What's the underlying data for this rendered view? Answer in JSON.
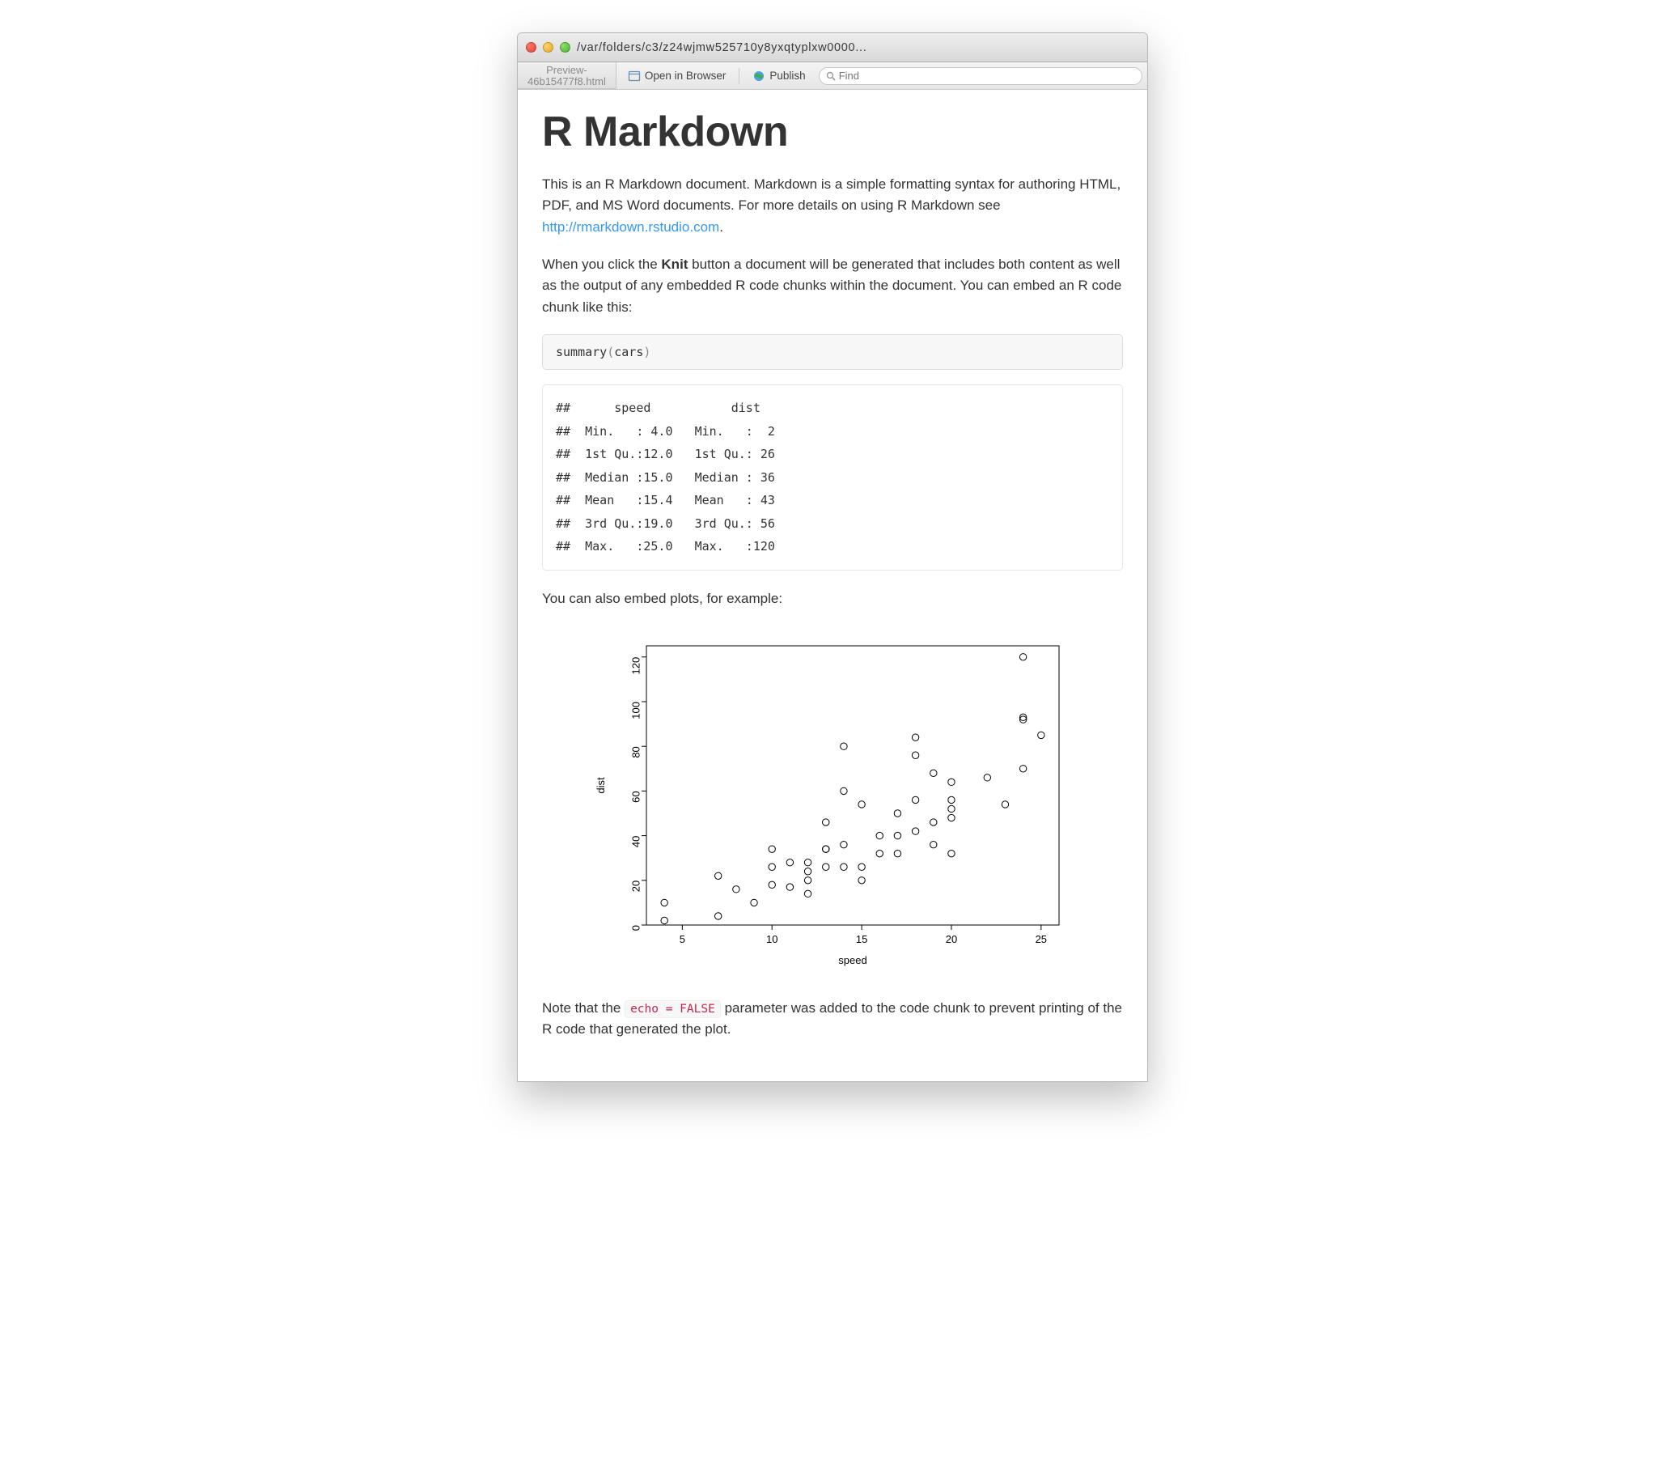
{
  "window": {
    "title_path": "/var/folders/c3/z24wjmw525710y8yxqtyplxw0000..."
  },
  "toolbar": {
    "tab": {
      "line1": "Preview-",
      "line2": "46b15477f8.html"
    },
    "open_label": "Open in Browser",
    "publish_label": "Publish",
    "search_placeholder": "Find"
  },
  "doc": {
    "heading": "R Markdown",
    "p1_a": "This is an R Markdown document. Markdown is a simple formatting syntax for authoring HTML, PDF, and MS Word documents. For more details on using R Markdown see ",
    "p1_link": "http://rmarkdown.rstudio.com",
    "p1_b": ".",
    "p2_a": "When you click the ",
    "p2_bold": "Knit",
    "p2_b": " button a document will be generated that includes both content as well as the output of any embedded R code chunks within the document. You can embed an R code chunk like this:",
    "code_fn": "summary",
    "code_arg": "cars",
    "output": "##      speed           dist    \n##  Min.   : 4.0   Min.   :  2  \n##  1st Qu.:12.0   1st Qu.: 26  \n##  Median :15.0   Median : 36  \n##  Mean   :15.4   Mean   : 43  \n##  3rd Qu.:19.0   3rd Qu.: 56  \n##  Max.   :25.0   Max.   :120",
    "p3": "You can also embed plots, for example:",
    "p4_a": "Note that the ",
    "p4_code": "echo = FALSE",
    "p4_b": " parameter was added to the code chunk to prevent printing of the R code that generated the plot."
  },
  "chart_data": {
    "type": "scatter",
    "xlabel": "speed",
    "ylabel": "dist",
    "xlim": [
      3,
      26
    ],
    "ylim": [
      0,
      125
    ],
    "xticks": [
      5,
      10,
      15,
      20,
      25
    ],
    "yticks": [
      0,
      20,
      40,
      60,
      80,
      100,
      120
    ],
    "points": [
      [
        4,
        2
      ],
      [
        4,
        10
      ],
      [
        7,
        4
      ],
      [
        7,
        22
      ],
      [
        8,
        16
      ],
      [
        9,
        10
      ],
      [
        10,
        18
      ],
      [
        10,
        26
      ],
      [
        10,
        34
      ],
      [
        11,
        17
      ],
      [
        11,
        28
      ],
      [
        12,
        14
      ],
      [
        12,
        20
      ],
      [
        12,
        24
      ],
      [
        12,
        28
      ],
      [
        13,
        26
      ],
      [
        13,
        34
      ],
      [
        13,
        34
      ],
      [
        13,
        46
      ],
      [
        14,
        26
      ],
      [
        14,
        36
      ],
      [
        14,
        60
      ],
      [
        14,
        80
      ],
      [
        15,
        20
      ],
      [
        15,
        26
      ],
      [
        15,
        54
      ],
      [
        16,
        32
      ],
      [
        16,
        40
      ],
      [
        17,
        32
      ],
      [
        17,
        40
      ],
      [
        17,
        50
      ],
      [
        18,
        42
      ],
      [
        18,
        56
      ],
      [
        18,
        76
      ],
      [
        18,
        84
      ],
      [
        19,
        36
      ],
      [
        19,
        46
      ],
      [
        19,
        68
      ],
      [
        20,
        32
      ],
      [
        20,
        48
      ],
      [
        20,
        52
      ],
      [
        20,
        56
      ],
      [
        20,
        64
      ],
      [
        22,
        66
      ],
      [
        23,
        54
      ],
      [
        24,
        70
      ],
      [
        24,
        92
      ],
      [
        24,
        93
      ],
      [
        24,
        120
      ],
      [
        25,
        85
      ]
    ]
  }
}
